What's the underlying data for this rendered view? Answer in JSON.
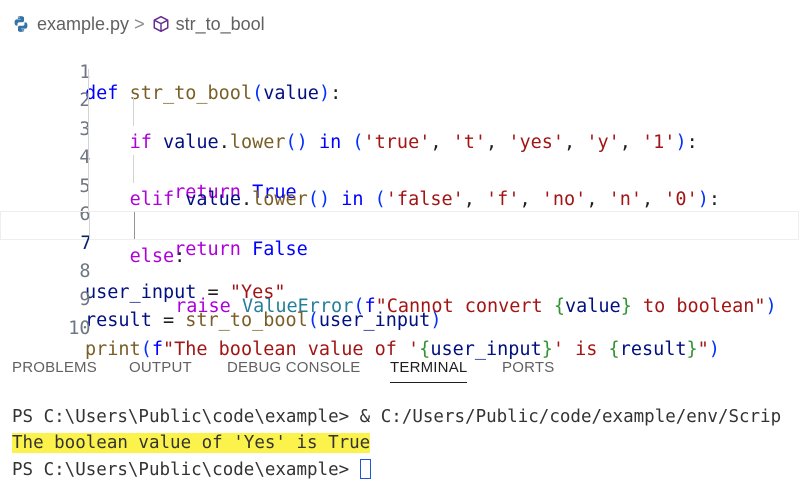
{
  "breadcrumb": {
    "file": "example.py",
    "separator": ">",
    "symbol": "str_to_bool"
  },
  "editor": {
    "lines": [
      {
        "n": "1"
      },
      {
        "n": "2"
      },
      {
        "n": "3"
      },
      {
        "n": "4"
      },
      {
        "n": "5"
      },
      {
        "n": "6"
      },
      {
        "n": "7"
      },
      {
        "n": "8"
      },
      {
        "n": "9"
      },
      {
        "n": "10"
      }
    ],
    "active_line": 7
  },
  "panel": {
    "tabs": [
      "PROBLEMS",
      "OUTPUT",
      "DEBUG CONSOLE",
      "TERMINAL",
      "PORTS"
    ],
    "active_tab": "TERMINAL"
  },
  "terminal": {
    "lines": [
      "PS C:\\Users\\Public\\code\\example> & C:/Users/Public/code/example/env/Scrip",
      "The boolean value of 'Yes' is True",
      "PS C:\\Users\\Public\\code\\example> "
    ]
  },
  "colors": {
    "keyword": "#0000ff",
    "control": "#af00db",
    "function": "#795e26",
    "variable": "#001080",
    "string": "#a31515",
    "class": "#267f99",
    "highlight": "#fbf24b"
  }
}
